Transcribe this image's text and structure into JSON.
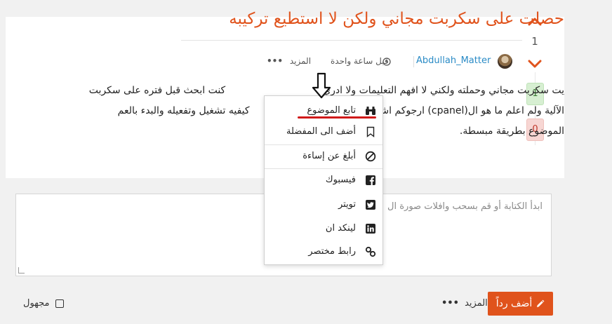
{
  "topic": {
    "title": "حصلت على سكربت مجاني ولكن لا استطيع تركيبه",
    "vote_count": "1",
    "author": "Abdullah_Matter",
    "time": "قبل ساعة واحدة",
    "more_label": "المزيد",
    "body_line1": "كنت ابحث قبل فتره على سكربت",
    "body_line1_end": "يت سكربت مجاني وحملته ولكني لا افهم التعليمات ولا ادري",
    "body_line2": "كيفيه تشغيل وتفعيله والبدء بالعم",
    "body_line2_end": "الآلية ولم اعلم ما هو ال(cpanel) ارجوكم اشرحوا لي",
    "body_line3": "الموضوع بطريقة مبسطة.",
    "upvotes": "1",
    "downvotes": "0"
  },
  "dropdown": {
    "items": [
      {
        "label": "تابع الموضوع",
        "icon": "binoculars-icon"
      },
      {
        "label": "أضف الى المفضلة",
        "icon": "bookmark-icon"
      },
      {
        "label": "أبلغ عن إساءة",
        "icon": "ban-icon"
      },
      {
        "label": "فيسبوك",
        "icon": "facebook-icon"
      },
      {
        "label": "تويتر",
        "icon": "twitter-icon"
      },
      {
        "label": "لينكد ان",
        "icon": "linkedin-icon"
      },
      {
        "label": "رابط مختصر",
        "icon": "link-icon"
      }
    ]
  },
  "editor": {
    "placeholder": "ابدأ الكتابة أو قم بسحب وافلات صورة ال"
  },
  "footer": {
    "reply_label": "أضف رداً",
    "more_label": "المزيد",
    "anonymous_label": "مجهول"
  },
  "colors": {
    "accent": "#e0531c",
    "link": "#2a8bc6",
    "annotation_red": "#d01a1a"
  }
}
